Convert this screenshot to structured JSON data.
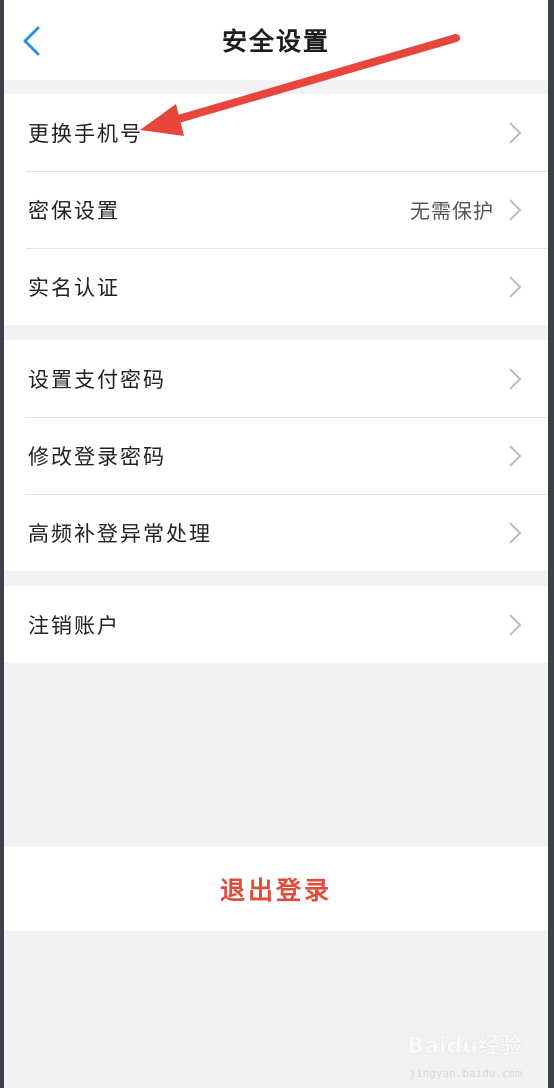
{
  "navbar": {
    "title": "安全设置",
    "back_icon": "chevron-left-icon",
    "accent_color": "#2f8de4"
  },
  "groups": [
    {
      "items": [
        {
          "label": "更换手机号",
          "value": ""
        },
        {
          "label": "密保设置",
          "value": "无需保护"
        },
        {
          "label": "实名认证",
          "value": ""
        }
      ]
    },
    {
      "items": [
        {
          "label": "设置支付密码",
          "value": ""
        },
        {
          "label": "修改登录密码",
          "value": ""
        },
        {
          "label": "高频补登异常处理",
          "value": ""
        }
      ]
    },
    {
      "items": [
        {
          "label": "注销账户",
          "value": ""
        }
      ]
    }
  ],
  "logout": {
    "label": "退出登录",
    "color": "#e04b3a"
  },
  "annotation": {
    "arrow_color": "#e8453c"
  },
  "watermark": {
    "text": "Baidu经验",
    "sub": "jingyan.baidu.com"
  }
}
